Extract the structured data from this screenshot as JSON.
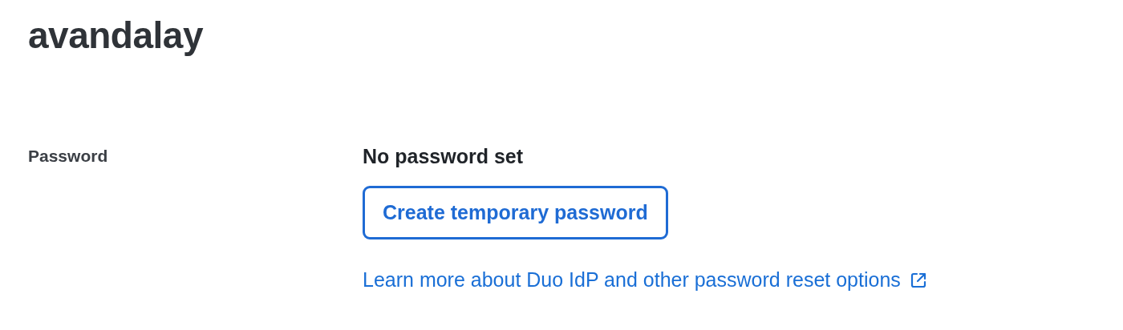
{
  "header": {
    "title": "avandalay"
  },
  "password": {
    "label": "Password",
    "status": "No password set",
    "button": "Create temporary password",
    "link": "Learn more about Duo IdP and other password reset options"
  }
}
